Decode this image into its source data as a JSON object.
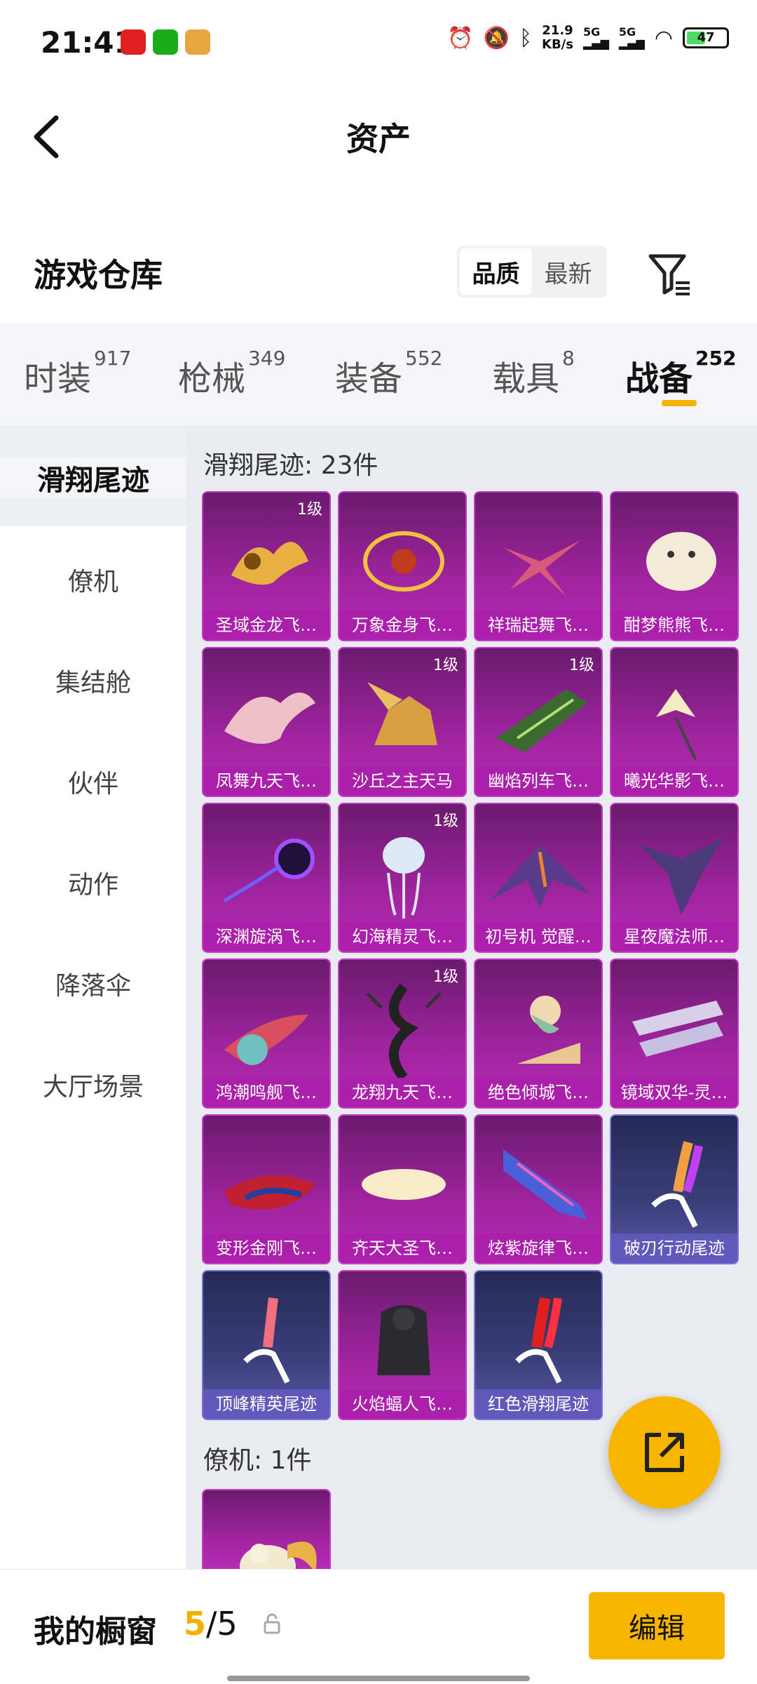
{
  "status_bar": {
    "time": "21:41",
    "speed_value": "21.9",
    "speed_unit": "KB/s",
    "sim1": "5G",
    "sim2": "5G",
    "battery": "47"
  },
  "header": {
    "title": "资产"
  },
  "warehouse": {
    "title": "游戏仓库",
    "sort_options": [
      "品质",
      "最新"
    ]
  },
  "tabs": [
    {
      "label": "时装",
      "count": "917"
    },
    {
      "label": "枪械",
      "count": "349"
    },
    {
      "label": "装备",
      "count": "552"
    },
    {
      "label": "载具",
      "count": "8"
    },
    {
      "label": "战备",
      "count": "252"
    }
  ],
  "sidebar": {
    "items": [
      "滑翔尾迹",
      "僚机",
      "集结舱",
      "伙伴",
      "动作",
      "降落伞",
      "大厅场景"
    ]
  },
  "sections": [
    {
      "title": "滑翔尾迹: 23件",
      "items": [
        {
          "name": "圣域金龙飞…",
          "level": "1级"
        },
        {
          "name": "万象金身飞…",
          "level": ""
        },
        {
          "name": "祥瑞起舞飞…",
          "level": ""
        },
        {
          "name": "酣梦熊熊飞…",
          "level": ""
        },
        {
          "name": "凤舞九天飞…",
          "level": ""
        },
        {
          "name": "沙丘之主天马",
          "level": "1级"
        },
        {
          "name": "幽焰列车飞…",
          "level": "1级"
        },
        {
          "name": "曦光华影飞…",
          "level": ""
        },
        {
          "name": "深渊旋涡飞…",
          "level": ""
        },
        {
          "name": "幻海精灵飞…",
          "level": "1级"
        },
        {
          "name": "初号机 觉醒…",
          "level": ""
        },
        {
          "name": "星夜魔法师…",
          "level": ""
        },
        {
          "name": "鸿潮鸣舰飞…",
          "level": ""
        },
        {
          "name": "龙翔九天飞…",
          "level": "1级"
        },
        {
          "name": "绝色倾城飞…",
          "level": ""
        },
        {
          "name": "镜域双华-灵…",
          "level": ""
        },
        {
          "name": "变形金刚飞…",
          "level": ""
        },
        {
          "name": "齐天大圣飞…",
          "level": ""
        },
        {
          "name": "炫紫旋律飞…",
          "level": ""
        },
        {
          "name": "破刃行动尾迹",
          "level": ""
        },
        {
          "name": "顶峰精英尾迹",
          "level": ""
        },
        {
          "name": "火焰蝠人飞…",
          "level": ""
        },
        {
          "name": "红色滑翔尾迹",
          "level": ""
        }
      ]
    },
    {
      "title": "僚机: 1件",
      "items": []
    }
  ],
  "bottom": {
    "label": "我的橱窗",
    "current": "5",
    "separator": "/",
    "total": "5",
    "edit_label": "编辑"
  },
  "colors": {
    "accent": "#f7b500",
    "purple_card": "#a0249f",
    "blue_card": "#3b3f7a"
  }
}
